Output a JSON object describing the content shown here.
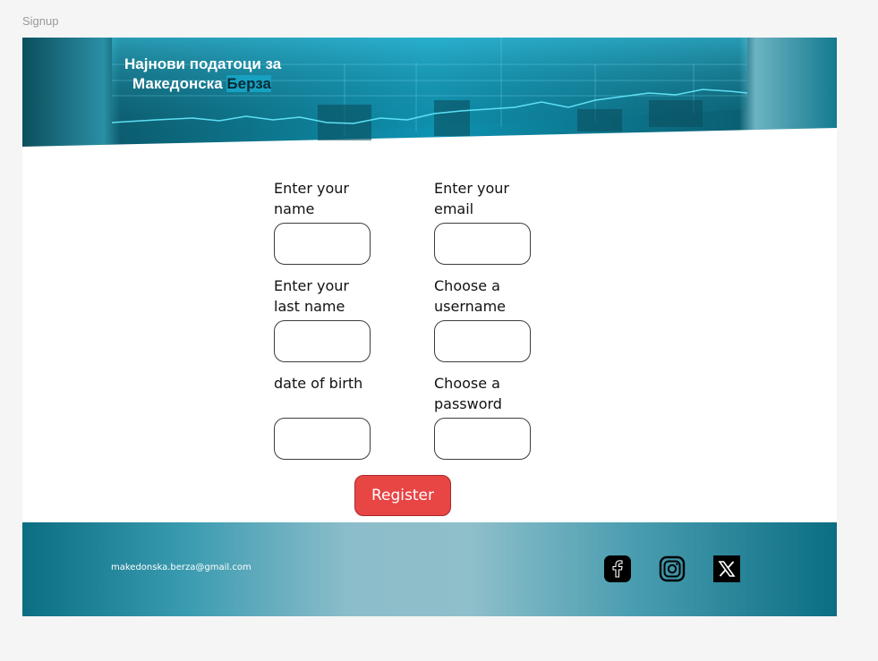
{
  "frame": {
    "label": "Signup"
  },
  "banner": {
    "title_line1": "Најнови податоци за",
    "title_line2_main": "Македонска",
    "title_line2_accent": "Берза"
  },
  "form": {
    "fields": [
      {
        "label_line1": "Enter your",
        "label_line2": "name",
        "value": "",
        "placeholder": ""
      },
      {
        "label_line1": "Enter your",
        "label_line2": "email",
        "value": "",
        "placeholder": ""
      },
      {
        "label_line1": "Enter your",
        "label_line2": "last name",
        "value": "",
        "placeholder": ""
      },
      {
        "label_line1": "Choose a",
        "label_line2": "username",
        "value": "",
        "placeholder": ""
      },
      {
        "label_line1": "date of birth",
        "label_line2": "",
        "value": "",
        "placeholder": ""
      },
      {
        "label_line1": "Choose a",
        "label_line2": "password",
        "value": "",
        "placeholder": ""
      }
    ],
    "register_label": "Register"
  },
  "footer": {
    "email": "makedonska.berza@gmail.com",
    "socials": [
      "facebook-icon",
      "instagram-icon",
      "x-icon"
    ]
  },
  "colors": {
    "banner_dark": "#0b5f70",
    "banner_light": "#1ca6c4",
    "register": "#e84545",
    "footer_edge": "#0b6e83",
    "footer_center": "#8ebfca"
  }
}
